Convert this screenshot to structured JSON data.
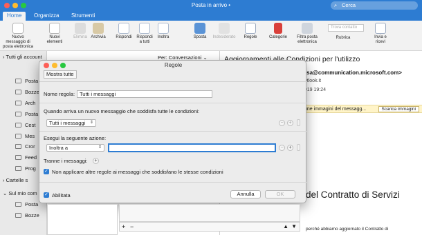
{
  "window": {
    "title": "Posta in arrivo • ",
    "search_placeholder": "Cerca"
  },
  "tabs": [
    "Home",
    "Organizza",
    "Strumenti"
  ],
  "ribbon": {
    "new_message": "Nuovo messaggio di posta elettronica",
    "new_items": "Nuovi elementi",
    "delete": "Elimina",
    "archive": "Archivia",
    "reply": "Rispondi",
    "reply_all": "Rispondi a tutti",
    "forward": "Inoltra",
    "move": "Sposta",
    "junk": "Indesiderato",
    "rules": "Regole",
    "categories": "Categorie",
    "filter": "Filtra posta elettronica",
    "find_contact": "Trova contatto",
    "address_book": "Rubrica",
    "send_receive": "Invia e ricevi"
  },
  "sidebar": {
    "all_accounts": "Tutti gli account",
    "folders": [
      "Posta",
      "Bozze",
      "Arch",
      "Posta",
      "Cest",
      "Mes",
      "Cror",
      "Feed",
      "Prog"
    ],
    "shared_folders": "Cartelle s",
    "my_computer": "Sul mio com",
    "bottom_folders": [
      "Posta",
      "Bozze"
    ]
  },
  "message_list": {
    "sort_label": "Per: Conversazioni"
  },
  "reading_pane": {
    "subject": "Aggiornamenti alle Condizioni per l'utilizzo",
    "from": "msa@communication.microsoft.com>",
    "to": "outlook.it",
    "date": "2019 19:24",
    "info_text": "une immagini del messagg...",
    "download_images": "Scarica immagini",
    "heading": "del Contratto di Servizi",
    "body_fragment": "perché abbiamo aggiornato il Contratto di"
  },
  "dialog": {
    "title": "Regole",
    "show_all": "Mostra tutte",
    "rule_name_label": "Nome regola:",
    "rule_name_value": "Tutti i messaggi",
    "conditions_label": "Quando arriva un nuovo messaggio che soddisfa tutte le condizioni:",
    "condition_value": "Tutti i messaggi",
    "actions_label": "Esegui la seguente azione:",
    "action_value": "Inoltra a",
    "action_target": "",
    "except_label": "Tranne i messaggi:",
    "stop_rules_label": "Non applicare altre regole ai messaggi che soddisfano le stesse condizioni",
    "stop_rules_checked": true,
    "enabled_label": "Abilitata",
    "enabled_checked": true,
    "cancel": "Annulla",
    "ok": "OK"
  }
}
